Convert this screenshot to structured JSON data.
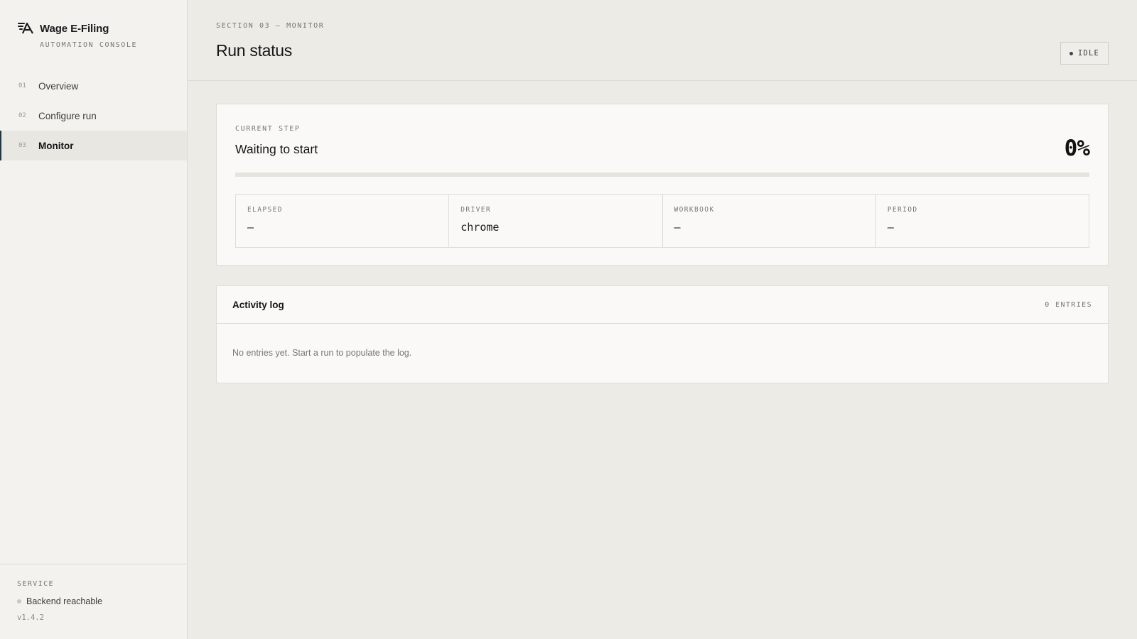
{
  "sidebar": {
    "app_title": "Wage E-Filing",
    "app_subtitle": "AUTOMATION CONSOLE",
    "logo_icon": "stylized-monogram-logo",
    "items": [
      {
        "num": "01",
        "label": "Overview",
        "active": false
      },
      {
        "num": "02",
        "label": "Configure run",
        "active": false
      },
      {
        "num": "03",
        "label": "Monitor",
        "active": true
      }
    ],
    "service": {
      "heading": "SERVICE",
      "status": "Backend reachable",
      "status_color": "#c9c8c2",
      "version": "v1.4.2"
    }
  },
  "header": {
    "eyebrow": "SECTION 03 — MONITOR",
    "title": "Run status",
    "badge": "IDLE"
  },
  "current_step": {
    "label": "CURRENT STEP",
    "title": "Waiting to start",
    "percent_text": "0%",
    "progress_fraction": 0,
    "stats": [
      {
        "key": "ELAPSED",
        "value": "—"
      },
      {
        "key": "DRIVER",
        "value": "chrome"
      },
      {
        "key": "WORKBOOK",
        "value": "—"
      },
      {
        "key": "PERIOD",
        "value": "—"
      }
    ]
  },
  "activity_log": {
    "title": "Activity log",
    "count": "0 ENTRIES",
    "empty_message": "No entries yet. Start a run to populate the log."
  },
  "colors": {
    "accent": "#243447",
    "background": "#ecebe6",
    "sidebar": "#f3f2ee",
    "card": "#faf9f7"
  }
}
